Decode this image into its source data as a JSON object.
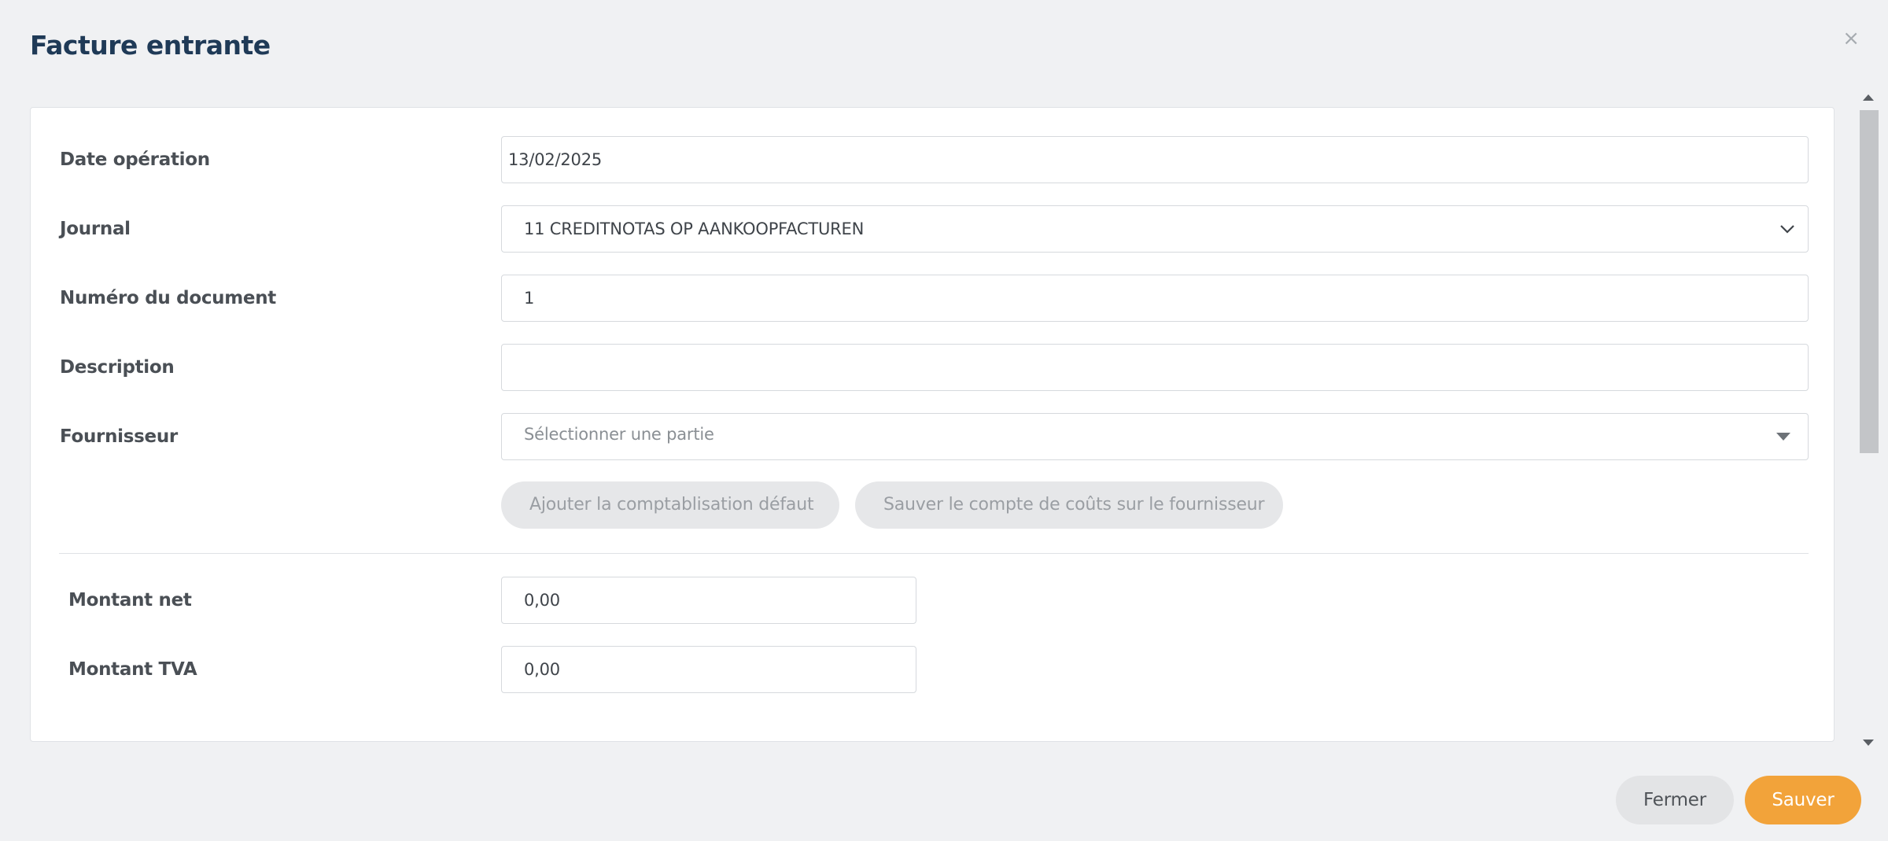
{
  "dialog": {
    "title": "Facture entrante",
    "close_icon": "×"
  },
  "form": {
    "date_label": "Date opération",
    "date_value": "13/02/2025",
    "journal_label": "Journal",
    "journal_value": "11 CREDITNOTAS OP AANKOOPFACTUREN",
    "docnum_label": "Numéro du document",
    "docnum_value": "1",
    "description_label": "Description",
    "description_value": "",
    "supplier_label": "Fournisseur",
    "supplier_placeholder": "Sélectionner une partie",
    "add_default_label": "Ajouter la comptablisation défaut",
    "save_cost_label": "Sauver le compte de coûts sur le fournisseur",
    "net_label": "Montant net",
    "net_value": "0,00",
    "vat_label": "Montant TVA",
    "vat_value": "0,00"
  },
  "footer": {
    "close_label": "Fermer",
    "save_label": "Sauver"
  },
  "colors": {
    "title": "#1f3a57",
    "primary": "#f2a33a",
    "secondary": "#e3e4e6"
  },
  "icons": {
    "close": "close-icon",
    "journal_dropdown": "chevron-down-icon",
    "supplier_dropdown": "caret-down-icon"
  }
}
